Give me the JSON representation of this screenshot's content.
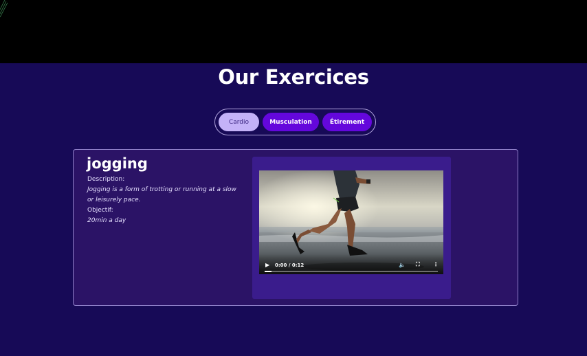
{
  "page": {
    "title": "Our Exercices"
  },
  "tabs": [
    {
      "label": "Cardio",
      "active": true
    },
    {
      "label": "Musculation",
      "active": false
    },
    {
      "label": "Étirement",
      "active": false
    }
  ],
  "exercise": {
    "name": "jogging",
    "description_label": "Description:",
    "description": "Jogging is a form of trotting or running at a slow or leisurely pace.",
    "objective_label": "Objectif:",
    "objective": "20min a day"
  },
  "video": {
    "time": "0:00 / 0:12",
    "progress": 0.04
  },
  "colors": {
    "background": "#170a57",
    "card": "#2b1366",
    "accent": "#6407dc",
    "active_tab": "#c4b2f8"
  }
}
